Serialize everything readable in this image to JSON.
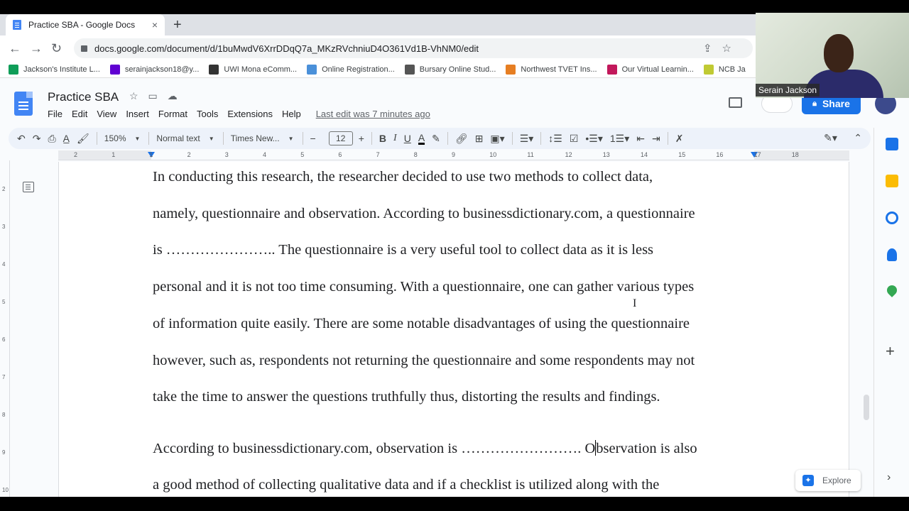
{
  "browser": {
    "tab_title": "Practice SBA - Google Docs",
    "tab_close": "×",
    "new_tab": "+",
    "url": "docs.google.com/document/d/1buMwdV6XrrDDqQ7a_MKzRVchniuD4O361Vd1B-VhNM0/edit",
    "bookmarks": [
      {
        "label": "Jackson's Institute L...",
        "color": "#0f9d58"
      },
      {
        "label": "serainjackson18@y...",
        "color": "#6001d2"
      },
      {
        "label": "UWI Mona eComm...",
        "color": "#333333"
      },
      {
        "label": "Online Registration...",
        "color": "#4a90d9"
      },
      {
        "label": "Bursary Online Stud...",
        "color": "#555555"
      },
      {
        "label": "Northwest TVET Ins...",
        "color": "#e67e22"
      },
      {
        "label": "Our Virtual Learnin...",
        "color": "#c2185b"
      },
      {
        "label": "NCB Ja",
        "color": "#c0ca33"
      }
    ]
  },
  "docs": {
    "title": "Practice SBA",
    "menu": [
      "File",
      "Edit",
      "View",
      "Insert",
      "Format",
      "Tools",
      "Extensions",
      "Help"
    ],
    "last_edit": "Last edit was 7 minutes ago",
    "share_label": "Share",
    "toolbar": {
      "zoom": "150%",
      "style": "Normal text",
      "font": "Times New...",
      "size": "12",
      "bold": "B",
      "italic": "I",
      "underline": "U",
      "text_color": "A",
      "minus": "−",
      "plus": "+"
    },
    "ruler_numbers": [
      "2",
      "1",
      "1",
      "2",
      "3",
      "4",
      "5",
      "6",
      "7",
      "8",
      "9",
      "10",
      "11",
      "12",
      "13",
      "14",
      "15",
      "16",
      "17",
      "18"
    ],
    "vruler_numbers": [
      "2",
      "3",
      "4",
      "5",
      "6",
      "7",
      "8",
      "9",
      "10"
    ],
    "paragraph1": [
      "In conducting this research, the researcher decided to use two methods to collect data,",
      "namely, questionnaire and observation. According to businessdictionary.com, a questionnaire",
      "is ………………….. The questionnaire is a very useful tool to collect data as it is less",
      "personal and it is not too time consuming. With a questionnaire, one can gather various types",
      "of information quite easily. There are some notable disadvantages of using the questionnaire",
      "however, such as, respondents not returning the questionnaire and some respondents may not",
      "take the time to answer the questions truthfully thus, distorting the results and findings."
    ],
    "paragraph2": {
      "line1_before_cursor": "According to businessdictionary.com, observation is ……………………. O",
      "line1_after_cursor": "bservation is also",
      "line2": "a good method of collecting qualitative data and if a checklist is utilized along with the"
    },
    "explore_label": "Explore"
  },
  "webcam": {
    "name": "Serain Jackson"
  },
  "colors": {
    "accent": "#1a73e8",
    "toolbar_bg": "#edf2fa",
    "page_bg": "#f9fbfd"
  }
}
